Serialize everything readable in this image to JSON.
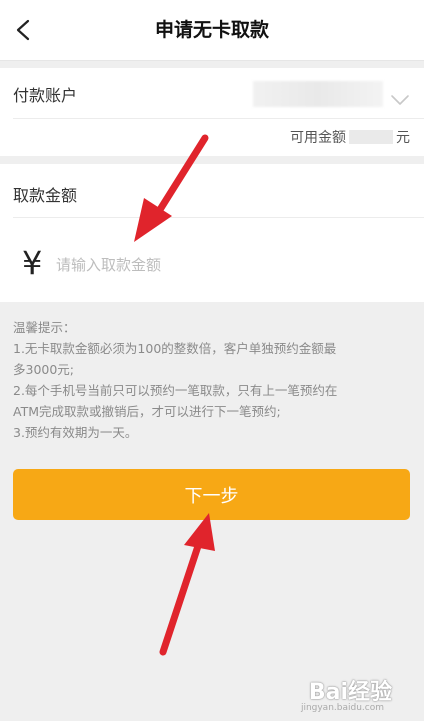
{
  "nav": {
    "title": "申请无卡取款"
  },
  "account": {
    "label": "付款账户",
    "available_label": "可用金额",
    "available_unit": "元"
  },
  "amount": {
    "label": "取款金额",
    "currency_symbol": "¥",
    "placeholder": "请输入取款金额"
  },
  "tips": {
    "title": "温馨提示：",
    "lines": [
      "1.无卡取款金额必须为100的整数倍，客户单独预约金额最",
      "多3000元;",
      "2.每个手机号当前只可以预约一笔取款，只有上一笔预约在",
      "ATM完成取款或撤销后，才可以进行下一笔预约;",
      "3.预约有效期为一天。"
    ]
  },
  "next_button": {
    "label": "下一步"
  },
  "watermark": {
    "text": "Bai经验",
    "sub": "jingyan.baidu.com"
  },
  "colors": {
    "accent": "#f7a815",
    "arrow": "#e0242c"
  }
}
